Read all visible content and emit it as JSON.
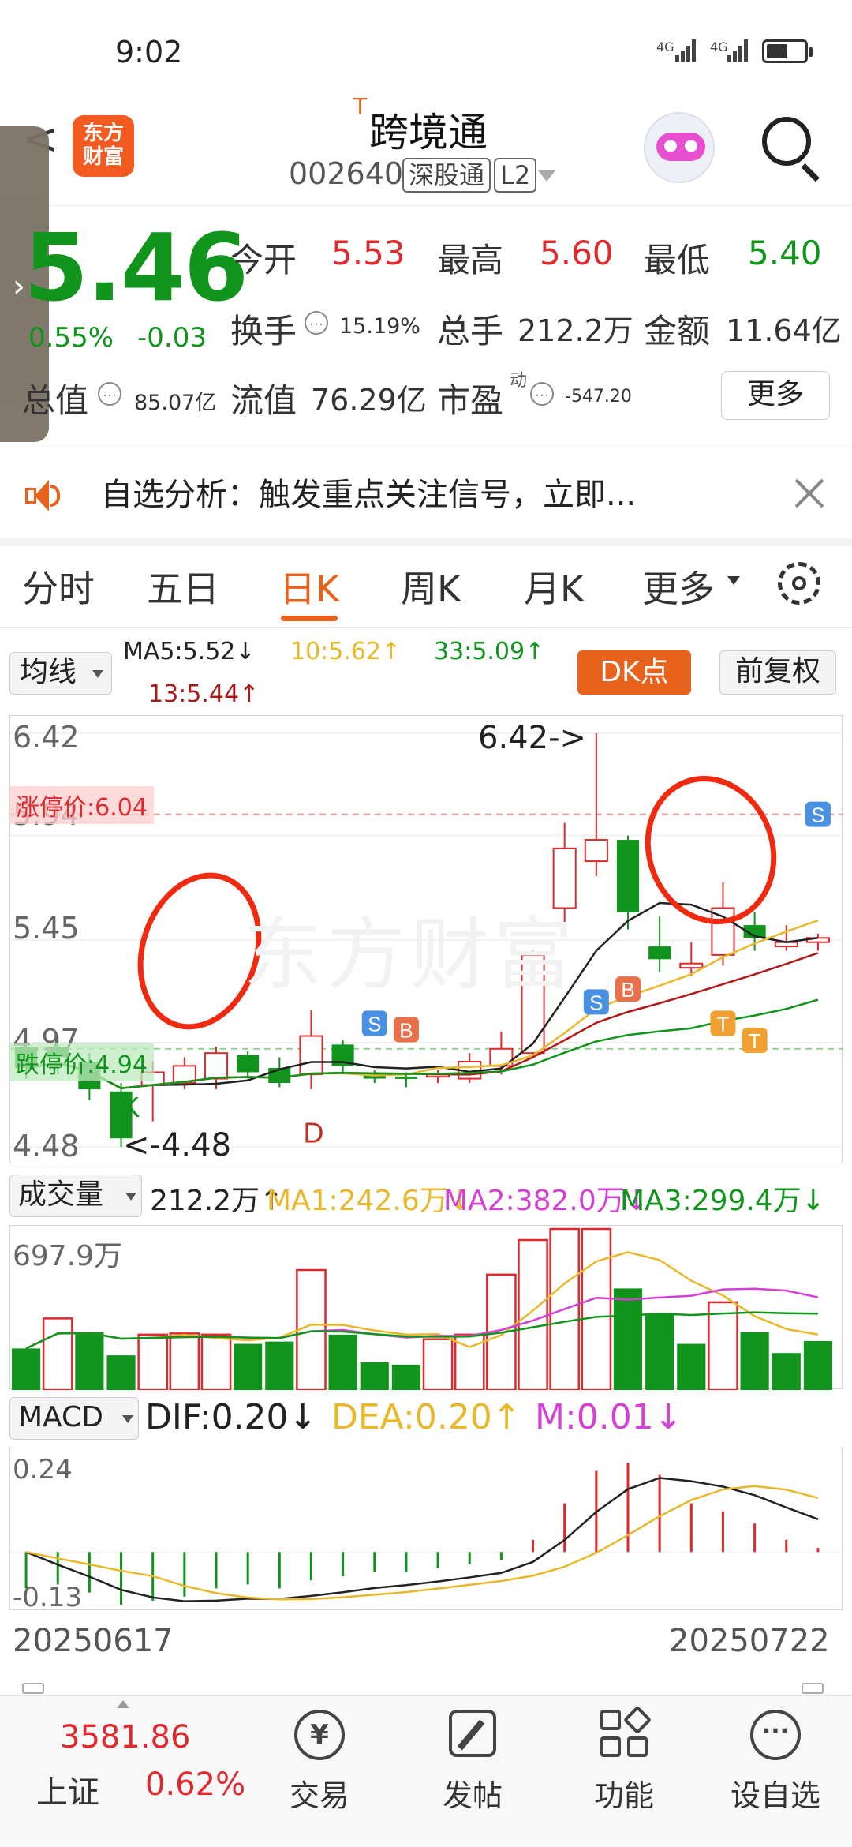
{
  "status_bar": {
    "time": "9:02",
    "signal_1": "4G",
    "signal_2": "4G"
  },
  "header": {
    "back_label": "<",
    "app_logo_text": [
      "东方",
      "财富"
    ],
    "stock_prefix": "T",
    "stock_name": "跨境通",
    "stock_code": "002640",
    "tag_connect": "深股通",
    "tag_level": "L2"
  },
  "quote": {
    "price": "5.46",
    "change_pct": "0.55%",
    "change": "-0.03",
    "market_cap_label": "总值",
    "market_cap_value": "85.07亿",
    "open_label": "今开",
    "open_value": "5.53",
    "high_label": "最高",
    "high_value": "5.60",
    "low_label": "最低",
    "low_value": "5.40",
    "turnover_label": "换手",
    "turnover_value": "15.19%",
    "volume_label": "总手",
    "volume_value": "212.2万",
    "amount_label": "金额",
    "amount_value": "11.64亿",
    "float_label": "流值",
    "float_value": "76.29亿",
    "pe_label": "市盈",
    "pe_superscript": "动",
    "pe_value": "-547.20",
    "more_label": "更多"
  },
  "notice": {
    "text": "自选分析：触发重点关注信号，立即..."
  },
  "tabs": [
    "分时",
    "五日",
    "日K",
    "周K",
    "月K",
    "更多"
  ],
  "active_tab": "日K",
  "kline": {
    "ma_selector": "均线",
    "ma5": "MA5:5.52↓",
    "ma10": "10:5.62↑",
    "ma33": "33:5.09↑",
    "ma13": "13:5.44↑",
    "dk_button": "DK点",
    "adjust_button": "前复权",
    "axis_top": "6.42",
    "axis_mid1": "5.94",
    "axis_mid2": "5.45",
    "axis_mid3": "4.97",
    "axis_bottom": "4.48",
    "limit_up_label": "涨停价:6.04",
    "limit_down_label": "跌停价:4.94",
    "high_marker": "6.42->",
    "low_marker": "<-4.48",
    "watermark": "东方财富",
    "signal_s": "S",
    "signal_b": "B",
    "signal_t": "T",
    "signal_k": "K",
    "signal_d": "D"
  },
  "volume": {
    "selector": "成交量",
    "value": "212.2万↑",
    "ma1": "MA1:242.6万↓",
    "ma2": "MA2:382.0万↓",
    "ma3": "MA3:299.4万↓",
    "axis_top": "697.9万"
  },
  "macd": {
    "selector": "MACD",
    "dif": "DIF:0.20↓",
    "dea": "DEA:0.20↑",
    "m": "M:0.01↓",
    "axis_top": "0.24",
    "axis_bottom": "-0.13"
  },
  "dates": {
    "start": "20250617",
    "end": "20250722"
  },
  "colors": {
    "up": "#e0292c",
    "down": "#10941c",
    "accent": "#e8621b",
    "ma10": "#e8b82a",
    "ma_magenta": "#d43fd4"
  },
  "chart_data": {
    "type": "candlestick",
    "x_start": "20250617",
    "x_end": "20250722",
    "ylim": [
      4.48,
      6.42
    ],
    "candles": [
      {
        "o": 4.95,
        "c": 4.85,
        "h": 5.0,
        "l": 4.8
      },
      {
        "o": 4.95,
        "c": 4.9,
        "h": 5.0,
        "l": 4.82
      },
      {
        "o": 4.88,
        "c": 4.75,
        "h": 4.92,
        "l": 4.7
      },
      {
        "o": 4.74,
        "c": 4.52,
        "h": 4.78,
        "l": 4.48
      },
      {
        "o": 4.77,
        "c": 4.83,
        "h": 4.88,
        "l": 4.6
      },
      {
        "o": 4.78,
        "c": 4.86,
        "h": 4.9,
        "l": 4.75
      },
      {
        "o": 4.8,
        "c": 4.92,
        "h": 4.95,
        "l": 4.75
      },
      {
        "o": 4.91,
        "c": 4.83,
        "h": 4.93,
        "l": 4.8
      },
      {
        "o": 4.85,
        "c": 4.78,
        "h": 4.9,
        "l": 4.76
      },
      {
        "o": 4.82,
        "c": 5.0,
        "h": 5.12,
        "l": 4.75
      },
      {
        "o": 4.96,
        "c": 4.86,
        "h": 4.98,
        "l": 4.82
      },
      {
        "o": 4.82,
        "c": 4.8,
        "h": 4.84,
        "l": 4.78
      },
      {
        "o": 4.81,
        "c": 4.8,
        "h": 4.83,
        "l": 4.76
      },
      {
        "o": 4.82,
        "c": 4.82,
        "h": 4.84,
        "l": 4.78
      },
      {
        "o": 4.8,
        "c": 4.88,
        "h": 4.92,
        "l": 4.78
      },
      {
        "o": 4.86,
        "c": 4.94,
        "h": 5.02,
        "l": 4.82
      },
      {
        "o": 4.92,
        "c": 5.38,
        "h": 5.4,
        "l": 4.9
      },
      {
        "o": 5.6,
        "c": 5.88,
        "h": 6.0,
        "l": 5.52
      },
      {
        "o": 5.82,
        "c": 5.92,
        "h": 6.42,
        "l": 5.75
      },
      {
        "o": 5.92,
        "c": 5.58,
        "h": 5.94,
        "l": 5.5
      },
      {
        "o": 5.42,
        "c": 5.36,
        "h": 5.56,
        "l": 5.3
      },
      {
        "o": 5.32,
        "c": 5.34,
        "h": 5.44,
        "l": 5.28
      },
      {
        "o": 5.38,
        "c": 5.6,
        "h": 5.72,
        "l": 5.33
      },
      {
        "o": 5.52,
        "c": 5.46,
        "h": 5.58,
        "l": 5.4
      },
      {
        "o": 5.42,
        "c": 5.44,
        "h": 5.52,
        "l": 5.4
      },
      {
        "o": 5.44,
        "c": 5.46,
        "h": 5.48,
        "l": 5.4
      }
    ],
    "volume": [
      180,
      310,
      250,
      150,
      240,
      245,
      240,
      200,
      210,
      520,
      240,
      120,
      110,
      220,
      240,
      500,
      650,
      697.9,
      697.9,
      440,
      330,
      200,
      380,
      250,
      160,
      212.2
    ],
    "volume_up": [
      false,
      true,
      false,
      false,
      true,
      true,
      true,
      false,
      false,
      true,
      false,
      false,
      false,
      true,
      true,
      true,
      true,
      true,
      true,
      false,
      false,
      false,
      true,
      false,
      false,
      false
    ],
    "volume_ylim": [
      0,
      697.9
    ],
    "macd_hist": [
      -0.09,
      -0.08,
      -0.1,
      -0.13,
      -0.12,
      -0.11,
      -0.09,
      -0.08,
      -0.09,
      -0.07,
      -0.06,
      -0.05,
      -0.05,
      -0.04,
      -0.03,
      -0.02,
      0.03,
      0.12,
      0.2,
      0.22,
      0.19,
      0.12,
      0.1,
      0.07,
      0.03,
      0.01
    ],
    "macd_ylim": [
      -0.13,
      0.24
    ]
  }
}
